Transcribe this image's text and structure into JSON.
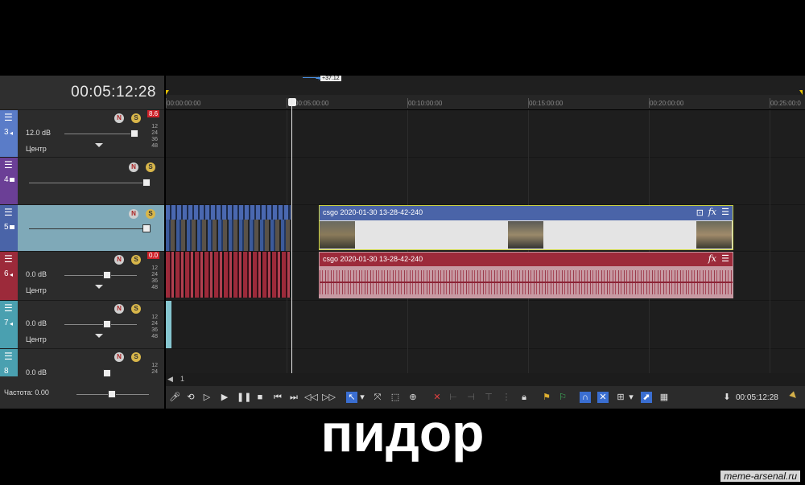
{
  "header": {
    "time": "00:05:12:28",
    "marker_label": "+37:12"
  },
  "ruler": {
    "ticks": [
      "00:00:00:00",
      "00:05:00:00",
      "00:10:00:00",
      "00:15:00:00",
      "00:20:00:00",
      "00:25:00:0"
    ]
  },
  "tracks": [
    {
      "number": "3",
      "type": "audio",
      "volume": "12.0 dB",
      "pan": "Центр",
      "level_badge": "8.6",
      "meter_ticks": [
        "12",
        "24",
        "36",
        "48"
      ]
    },
    {
      "number": "4",
      "type": "video"
    },
    {
      "number": "5",
      "type": "video",
      "selected": true
    },
    {
      "number": "6",
      "type": "audio",
      "volume": "0.0 dB",
      "pan": "Центр",
      "level_badge": "0.0",
      "meter_ticks": [
        "12",
        "24",
        "36",
        "48"
      ]
    },
    {
      "number": "7",
      "type": "audio",
      "volume": "0.0 dB",
      "pan": "Центр",
      "meter_ticks": [
        "12",
        "24",
        "36",
        "48"
      ]
    },
    {
      "number": "8",
      "type": "audio",
      "volume": "0.0 dB",
      "meter_ticks": [
        "12",
        "24"
      ]
    }
  ],
  "track_buttons": {
    "mute": "N",
    "solo": "S"
  },
  "clips": {
    "video_title": "csgo 2020-01-30 13-28-42-240",
    "audio_title": "csgo 2020-01-30 13-28-42-240"
  },
  "bottom": {
    "rate_label": "Частота: 0.00",
    "end_time": "00:05:12:28",
    "scroll_label": "1"
  },
  "caption": "пидор",
  "watermark": "meme-arsenal.ru",
  "colors": {
    "video_track": "#4a64a8",
    "audio_track": "#9c2a3a",
    "track3_strip": "#5a7cc8",
    "track4_strip": "#6b3f96",
    "track7_strip": "#4aa0b0",
    "clip_border": "#c9d040",
    "selected_track": "#7fa9b8"
  }
}
